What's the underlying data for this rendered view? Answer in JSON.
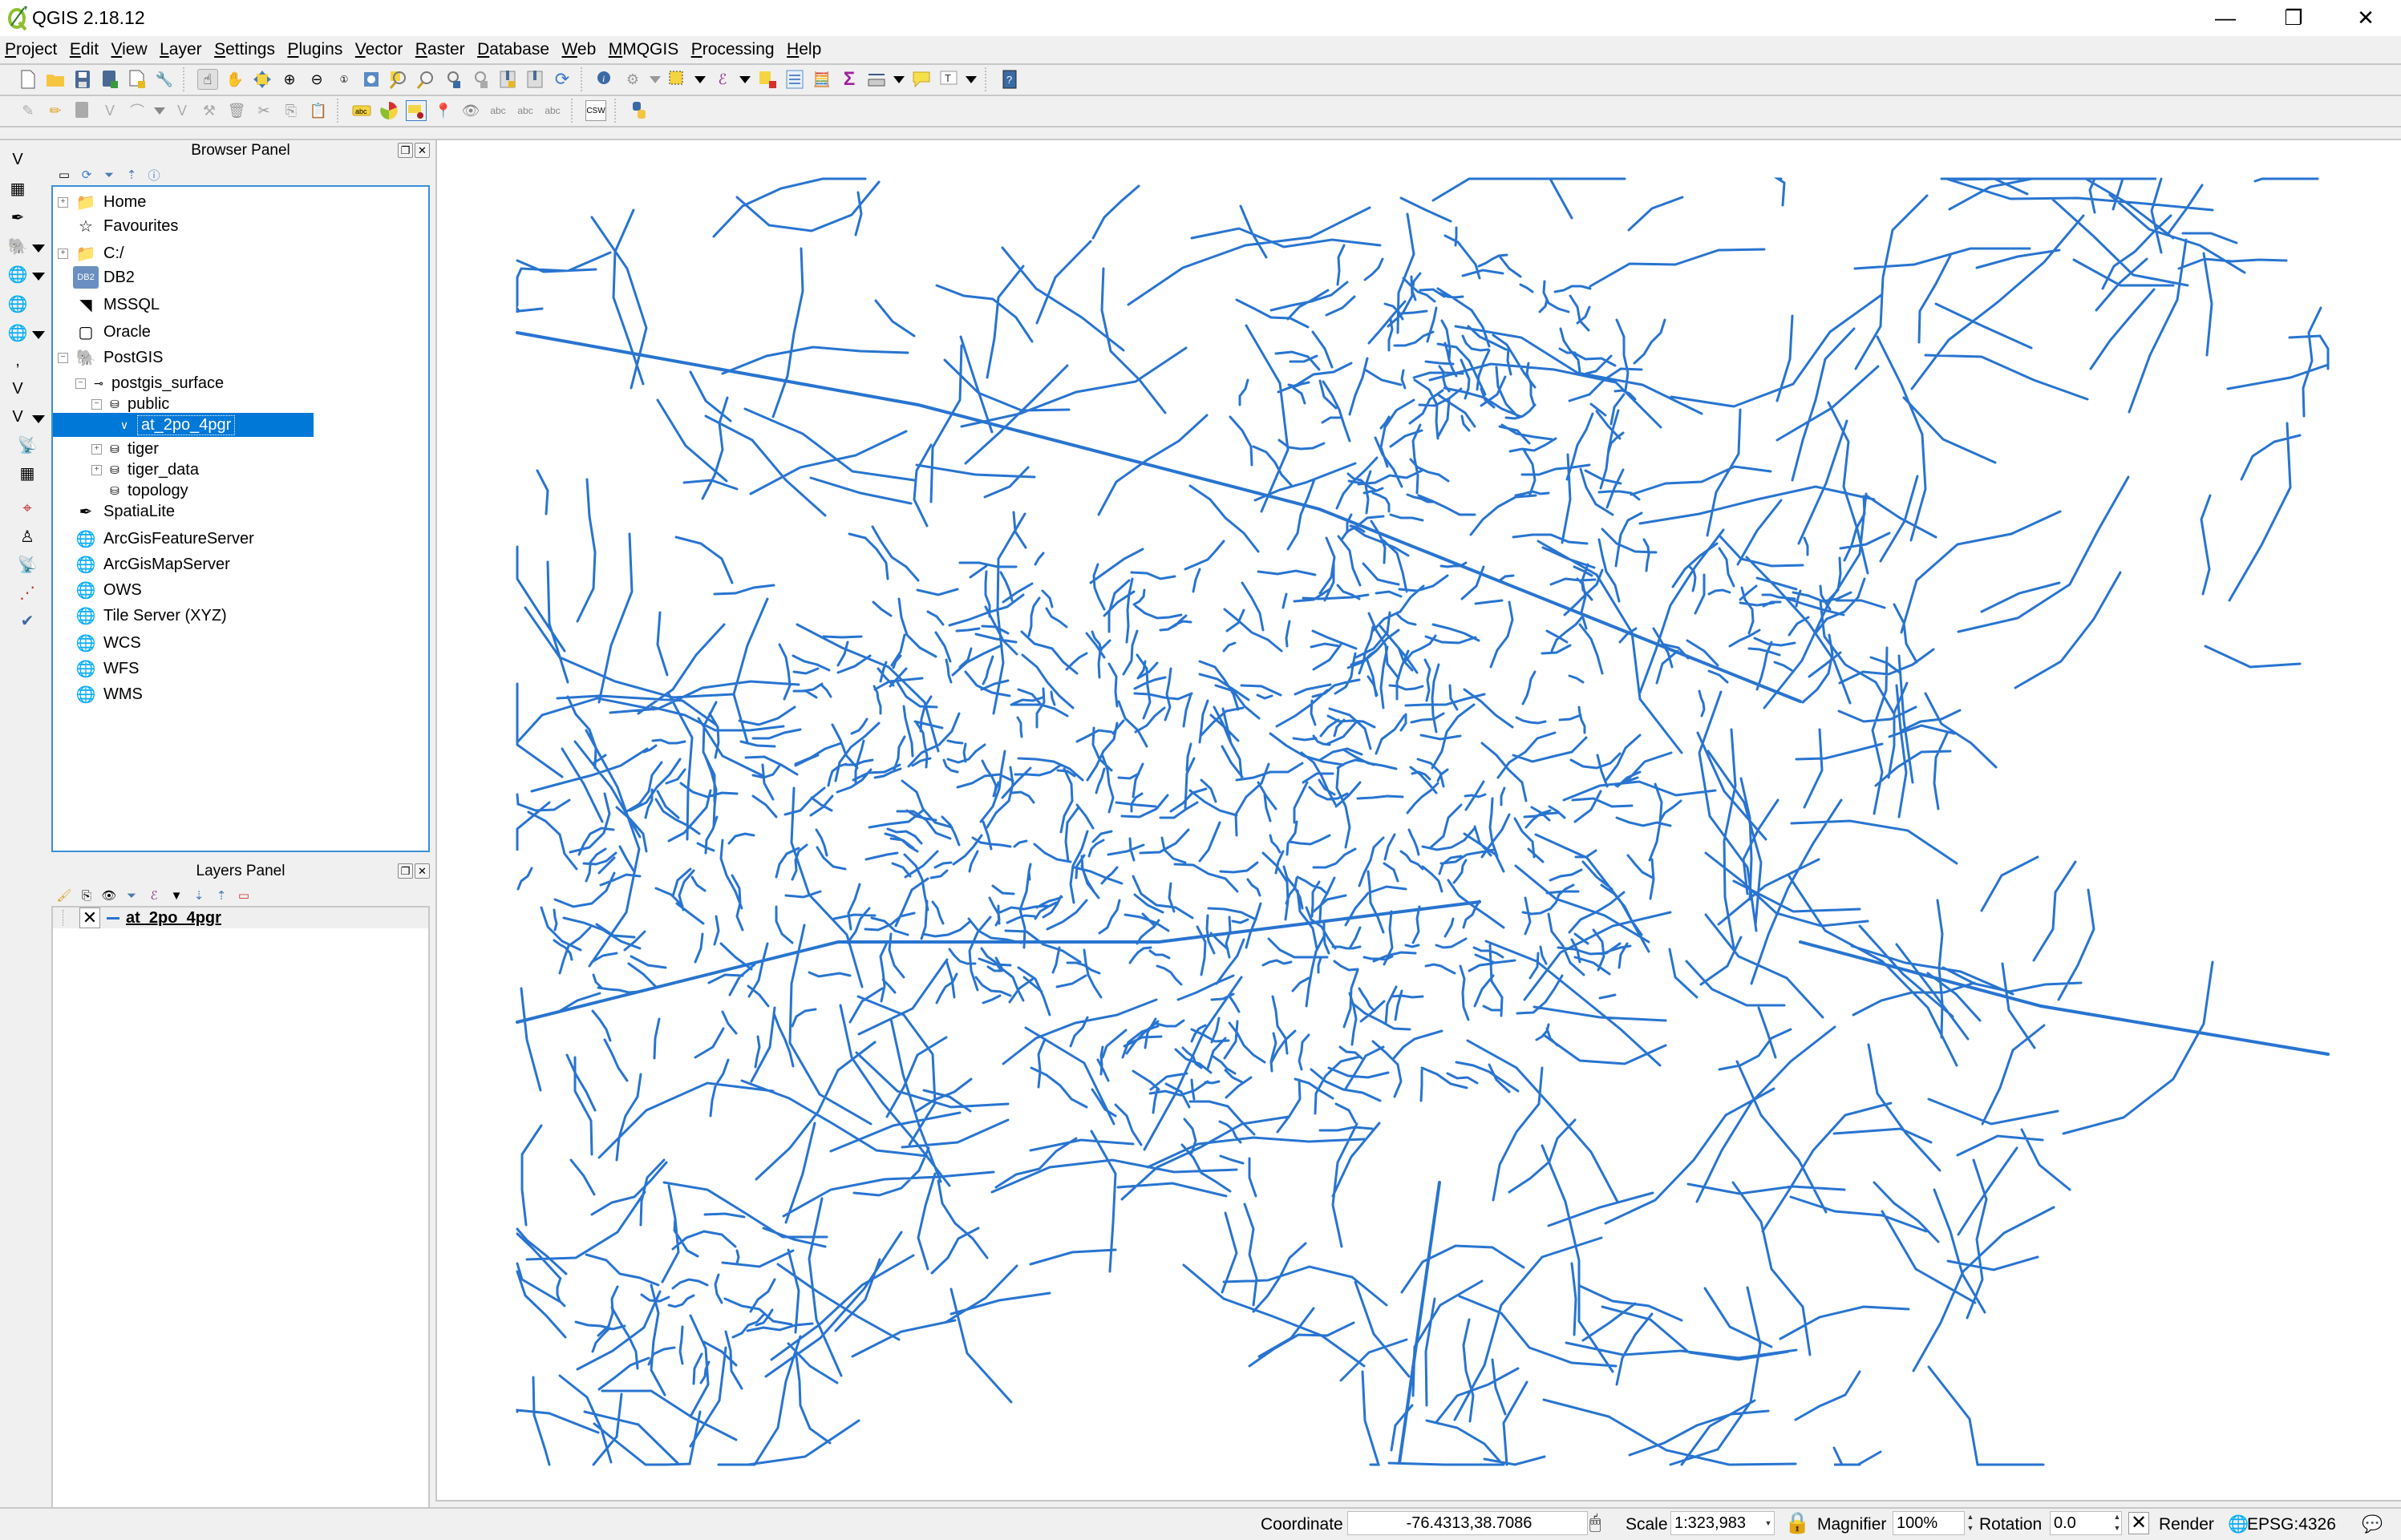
{
  "window": {
    "title": "QGIS 2.18.12",
    "controls": {
      "minimize": "—",
      "restore": "❐",
      "close": "✕"
    }
  },
  "menubar": {
    "items": [
      "Project",
      "Edit",
      "View",
      "Layer",
      "Settings",
      "Plugins",
      "Vector",
      "Raster",
      "Database",
      "Web",
      "MMQGIS",
      "Processing",
      "Help"
    ]
  },
  "toolbar1": {
    "icons": [
      "new-project-icon",
      "open-project-icon",
      "save-project-icon",
      "save-as-icon",
      "new-print-composer-icon",
      "composer-manager-icon",
      "touch-zoom-pan-icon",
      "pan-icon",
      "pan-to-selection-icon",
      "zoom-in-icon",
      "zoom-out-icon",
      "zoom-native-icon",
      "zoom-full-icon",
      "zoom-to-selection-icon",
      "zoom-to-layer-icon",
      "zoom-last-icon",
      "zoom-next-icon",
      "new-bookmark-icon",
      "show-bookmarks-icon",
      "refresh-icon",
      "identify-icon",
      "run-action-icon",
      "select-features-icon",
      "select-by-expression-icon",
      "deselect-icon",
      "attribute-table-icon",
      "field-calculator-icon",
      "statistics-icon",
      "measure-icon",
      "map-tips-icon",
      "text-annotation-icon",
      "help-icon"
    ]
  },
  "toolbar2": {
    "icons": [
      "current-edits-icon",
      "toggle-editing-icon",
      "save-layer-edits-icon",
      "add-feature-icon",
      "add-circular-string-icon",
      "move-feature-icon",
      "node-tool-icon",
      "delete-selected-icon",
      "cut-features-icon",
      "copy-features-icon",
      "paste-features-icon",
      "layer-labeling-icon",
      "diagram-icon",
      "highlight-pinned-labels-icon",
      "pin-labels-icon",
      "show-hide-labels-icon",
      "move-label-icon",
      "rotate-label-icon",
      "change-label-icon",
      "csw-icon",
      "python-console-icon"
    ]
  },
  "left_toolbar": {
    "icons": [
      "add-vector-layer-icon",
      "add-raster-layer-icon",
      "add-spatialite-layer-icon",
      "add-postgis-layer-icon",
      "add-wms-layer-icon",
      "add-wcs-layer-icon",
      "add-wfs-layer-icon",
      "add-delimited-text-icon",
      "add-virtual-layer-icon",
      "new-shapefile-icon",
      "gps-tool-icon",
      "new-geopackage-icon",
      "advanced-digitize-icon",
      "sketch-tool-icon",
      "gps-tracking-icon",
      "topology-checker-icon",
      "geometry-checker-icon"
    ]
  },
  "browser_panel": {
    "title": "Browser Panel",
    "tools": [
      "add-selected-layers-icon",
      "refresh-icon",
      "filter-icon",
      "collapse-all-icon",
      "properties-icon"
    ],
    "tree": [
      {
        "label": "Home",
        "icon": "folder-icon",
        "level": 0,
        "expander": "+"
      },
      {
        "label": "Favourites",
        "icon": "star-icon",
        "level": 0,
        "expander": ""
      },
      {
        "label": "C:/",
        "icon": "folder-icon",
        "level": 0,
        "expander": "+"
      },
      {
        "label": "DB2",
        "icon": "db2-icon",
        "level": 0,
        "expander": ""
      },
      {
        "label": "MSSQL",
        "icon": "mssql-icon",
        "level": 0,
        "expander": ""
      },
      {
        "label": "Oracle",
        "icon": "oracle-icon",
        "level": 0,
        "expander": ""
      },
      {
        "label": "PostGIS",
        "icon": "postgis-icon",
        "level": 0,
        "expander": "−"
      },
      {
        "label": "postgis_surface",
        "icon": "connection-icon",
        "level": 1,
        "expander": "−"
      },
      {
        "label": "public",
        "icon": "schema-icon",
        "level": 2,
        "expander": "−"
      },
      {
        "label": "at_2po_4pgr",
        "icon": "line-layer-icon",
        "level": 3,
        "expander": "",
        "selected": true
      },
      {
        "label": "tiger",
        "icon": "schema-icon",
        "level": 2,
        "expander": "+"
      },
      {
        "label": "tiger_data",
        "icon": "schema-icon",
        "level": 2,
        "expander": "+"
      },
      {
        "label": "topology",
        "icon": "schema-icon",
        "level": 2,
        "expander": ""
      },
      {
        "label": "SpatiaLite",
        "icon": "spatialite-icon",
        "level": 0,
        "expander": ""
      },
      {
        "label": "ArcGisFeatureServer",
        "icon": "arcgis-feature-icon",
        "level": 0,
        "expander": ""
      },
      {
        "label": "ArcGisMapServer",
        "icon": "arcgis-map-icon",
        "level": 0,
        "expander": ""
      },
      {
        "label": "OWS",
        "icon": "ows-icon",
        "level": 0,
        "expander": ""
      },
      {
        "label": "Tile Server (XYZ)",
        "icon": "xyz-icon",
        "level": 0,
        "expander": ""
      },
      {
        "label": "WCS",
        "icon": "wcs-icon",
        "level": 0,
        "expander": ""
      },
      {
        "label": "WFS",
        "icon": "wfs-icon",
        "level": 0,
        "expander": ""
      },
      {
        "label": "WMS",
        "icon": "wms-icon",
        "level": 0,
        "expander": ""
      }
    ]
  },
  "layers_panel": {
    "title": "Layers Panel",
    "tools": [
      "style-icon",
      "add-group-icon",
      "visibility-icon",
      "filter-legend-icon",
      "filter-expression-icon",
      "dropdown-icon",
      "expand-all-icon",
      "collapse-all-icon",
      "remove-layer-icon"
    ],
    "layers": [
      {
        "name": "at_2po_4pgr",
        "visible": true,
        "symbol_color": "#2874d0"
      }
    ]
  },
  "map": {
    "layer": "at_2po_4pgr",
    "line_color": "#2874d0",
    "background": "#ffffff"
  },
  "statusbar": {
    "coordinate_label": "Coordinate",
    "coordinate_value": "-76.4313,38.7086",
    "scale_label": "Scale",
    "scale_value": "1:323,983",
    "magnifier_label": "Magnifier",
    "magnifier_value": "100%",
    "rotation_label": "Rotation",
    "rotation_value": "0.0",
    "render_label": "Render",
    "render_checked": true,
    "crs": "EPSG:4326"
  },
  "colors": {
    "selection": "#0078d7",
    "panel_bg": "#f0f0f0",
    "tree_border": "#3c8fd8"
  }
}
